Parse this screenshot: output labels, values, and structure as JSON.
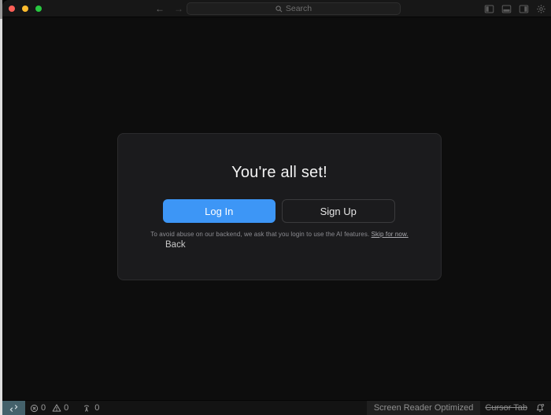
{
  "titlebar": {
    "search_placeholder": "Search",
    "nav": {
      "back": "←",
      "forward": "→"
    }
  },
  "dialog": {
    "title": "You're all set!",
    "login_label": "Log In",
    "signup_label": "Sign Up",
    "notice_text": "To avoid abuse on our backend, we ask that you login to use the AI features.",
    "skip_link": "Skip for now.",
    "back_label": "Back"
  },
  "statusbar": {
    "errors": "0",
    "warnings": "0",
    "ports": "0",
    "screen_reader_label": "Screen Reader Optimized",
    "cursor_tab_label": "Cursor Tab"
  },
  "colors": {
    "accent_blue": "#3d96f6",
    "remote_teal": "#44616b",
    "traffic_red": "#ff5f57",
    "traffic_yellow": "#febc2e",
    "traffic_green": "#28c840",
    "dialog_bg": "#1b1b1d",
    "window_bg": "#0d0d0d"
  }
}
